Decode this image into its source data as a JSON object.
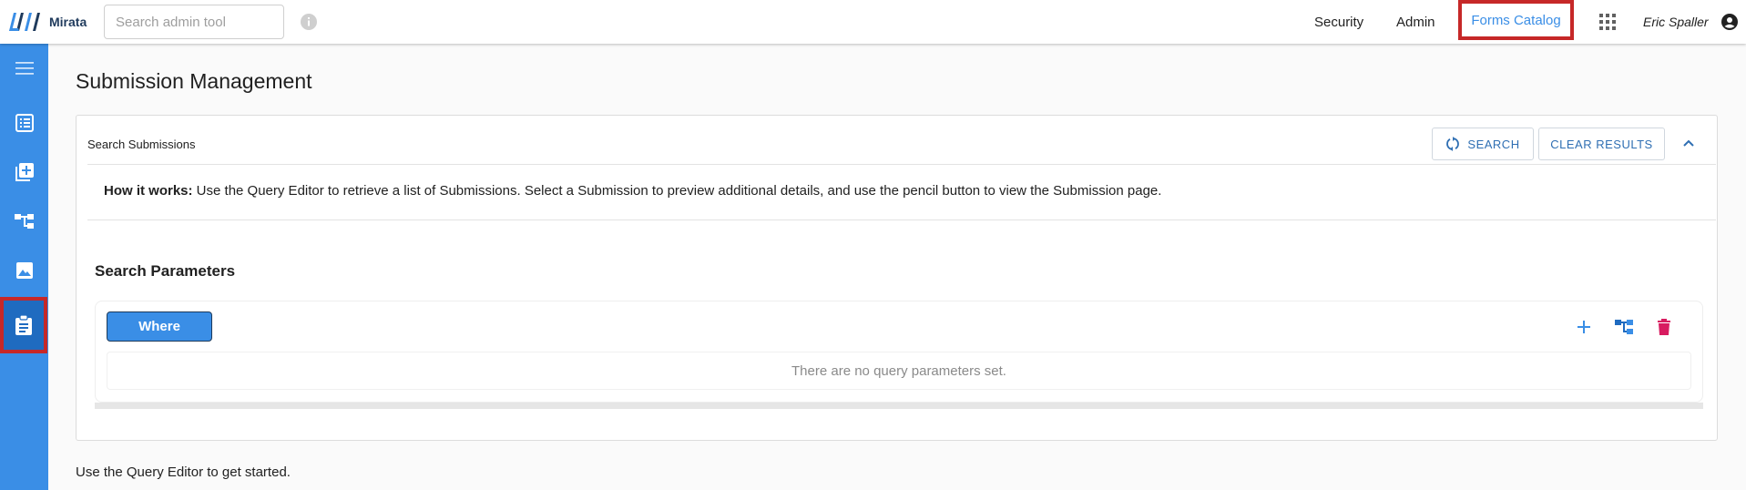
{
  "app": {
    "name": "Mirata"
  },
  "search": {
    "placeholder": "Search admin tool"
  },
  "nav": {
    "security": "Security",
    "admin": "Admin",
    "forms_catalog": "Forms Catalog",
    "user_name": "Eric Spaller"
  },
  "sidebar": {
    "items": [
      {
        "icon": "menu-icon"
      },
      {
        "icon": "list-icon"
      },
      {
        "icon": "add-box-icon"
      },
      {
        "icon": "hierarchy-icon"
      },
      {
        "icon": "image-icon"
      },
      {
        "icon": "clipboard-icon",
        "active": true
      }
    ]
  },
  "page": {
    "title": "Submission Management"
  },
  "panel": {
    "title": "Search Submissions",
    "search_label": "SEARCH",
    "clear_label": "CLEAR RESULTS",
    "how_it_works_label": "How it works:",
    "how_it_works_text": " Use the Query Editor to retrieve a list of Submissions. Select a Submission to preview additional details, and use the pencil button to view the Submission page."
  },
  "params": {
    "title": "Search Parameters",
    "where_label": "Where",
    "empty_text": "There are no query parameters set."
  },
  "footer": {
    "text": "Use the Query Editor to get started."
  },
  "colors": {
    "accent": "#3a8ee6",
    "highlight": "#c62828",
    "delete": "#d81b60"
  }
}
